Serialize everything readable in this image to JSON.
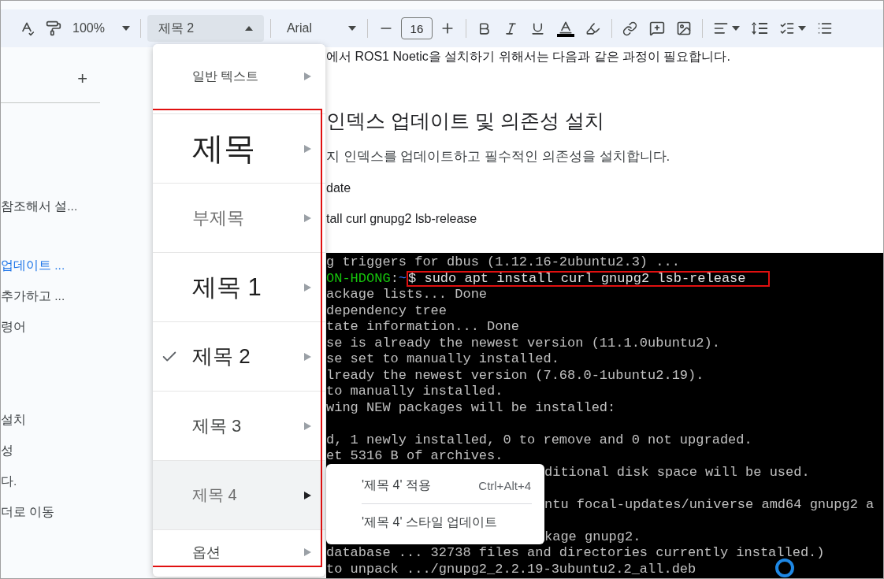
{
  "toolbar": {
    "zoom": "100%",
    "style": "제목 2",
    "style_open": true,
    "font": "Arial",
    "font_size": "16"
  },
  "sidebar": {
    "add_label": "+",
    "groups": [
      [
        {
          "text": "참조해서 설...",
          "selected": false
        }
      ],
      [
        {
          "text": "업데이트 ...",
          "selected": true
        },
        {
          "text": "추가하고 ...",
          "selected": false
        },
        {
          "text": "령어",
          "selected": false
        }
      ],
      [
        {
          "text": "설치",
          "selected": false
        },
        {
          "text": "성",
          "selected": false
        },
        {
          "text": "다.",
          "selected": false
        },
        {
          "text": "더로 이동",
          "selected": false
        }
      ]
    ]
  },
  "document": {
    "intro": "에서 ROS1 Noetic을 설치하기 위해서는 다음과 같은 과정이 필요합니다.",
    "heading": "인덱스 업데이트 및 의존성 설치",
    "paragraph": "지 인덱스를 업데이트하고 필수적인 의존성을 설치합니다.",
    "code_lines": [
      "date",
      "tall curl gnupg2 lsb-release"
    ]
  },
  "terminal": {
    "lines": [
      {
        "kind": "output",
        "text": "g triggers for dbus (1.12.16-2ubuntu2.3) ..."
      },
      {
        "kind": "prompt",
        "host": "ON-HDONG",
        "sep": ":",
        "path": "~",
        "command": "$ sudo apt install curl gnupg2 lsb-release",
        "highlighted": true
      },
      {
        "kind": "output",
        "text": "ackage lists... Done"
      },
      {
        "kind": "output",
        "text": "dependency tree"
      },
      {
        "kind": "output",
        "text": "tate information... Done"
      },
      {
        "kind": "output",
        "text": "se is already the newest version (11.1.0ubuntu2)."
      },
      {
        "kind": "output",
        "text": "se set to manually installed."
      },
      {
        "kind": "output",
        "text": "lready the newest version (7.68.0-1ubuntu2.19)."
      },
      {
        "kind": "output",
        "text": "to manually installed."
      },
      {
        "kind": "output",
        "text": "wing NEW packages will be installed:"
      },
      {
        "kind": "blank"
      },
      {
        "kind": "output",
        "text": "d, 1 newly installed, 0 to remove and 0 not upgraded."
      },
      {
        "kind": "output",
        "text": "et 5316 B of archives."
      },
      {
        "kind": "behind_popup",
        "text": "ditional disk space will be used."
      },
      {
        "kind": "blank"
      },
      {
        "kind": "behind_popup",
        "text": "ntu focal-updates/universe amd64 gnupg2 a"
      },
      {
        "kind": "blank"
      },
      {
        "kind": "behind_popup",
        "text": "kage gnupg2."
      },
      {
        "kind": "output",
        "text": "database ... 32738 files and directories currently installed.)"
      },
      {
        "kind": "output",
        "text": "to unpack .../gnupg2_2.2.19-3ubuntu2.2_all.deb"
      }
    ]
  },
  "style_menu": {
    "groups": [
      {
        "framed": false,
        "items": [
          {
            "label": "일반 텍스트",
            "kind": "normal",
            "checked": false,
            "hovered": false
          }
        ]
      },
      {
        "framed": true,
        "items": [
          {
            "label": "제목",
            "kind": "title",
            "checked": false,
            "hovered": false
          },
          {
            "label": "부제목",
            "kind": "subtitle",
            "checked": false,
            "hovered": false
          },
          {
            "label": "제목 1",
            "kind": "h1",
            "checked": false,
            "hovered": false
          },
          {
            "label": "제목 2",
            "kind": "h2",
            "checked": true,
            "hovered": false
          },
          {
            "label": "제목 3",
            "kind": "h3",
            "checked": false,
            "hovered": false
          },
          {
            "label": "제목 4",
            "kind": "h4",
            "checked": false,
            "hovered": true
          },
          {
            "label": "옵션",
            "kind": "options",
            "checked": false,
            "hovered": false
          }
        ]
      }
    ]
  },
  "submenu": {
    "items": [
      {
        "label": "'제목 4' 적용",
        "shortcut": "Ctrl+Alt+4"
      },
      {
        "label": "'제목 4' 스타일 업데이트"
      }
    ]
  }
}
